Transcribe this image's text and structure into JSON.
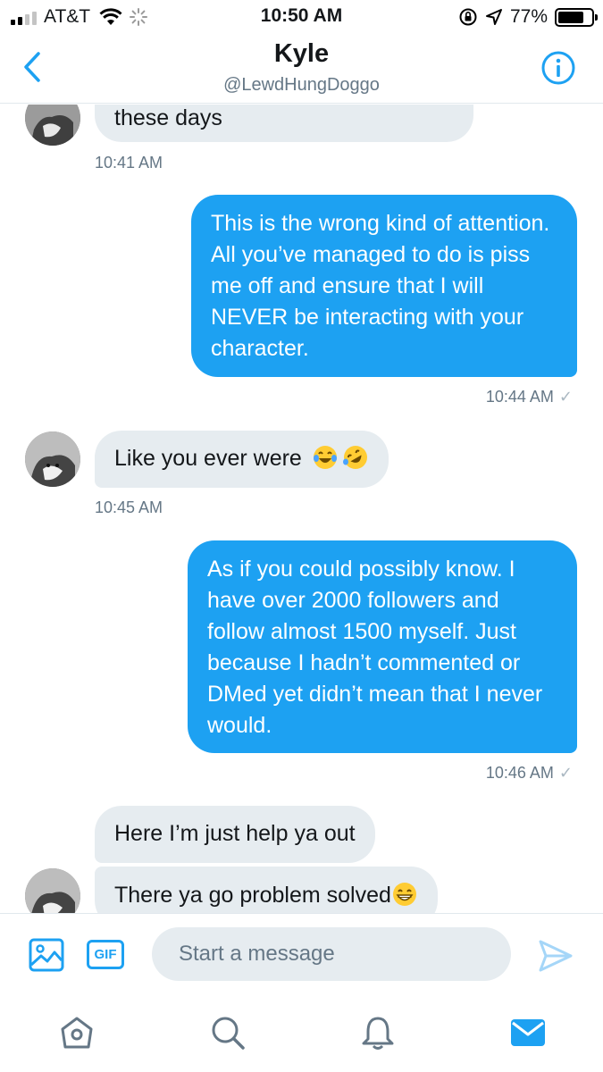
{
  "status_bar": {
    "carrier": "AT&T",
    "time": "10:50 AM",
    "battery": "77%",
    "battery_level": 0.77,
    "signal_bars": 2
  },
  "header": {
    "title": "Kyle",
    "handle": "@LewdHungDoggo",
    "back_icon": "chevron-left-icon",
    "info_icon": "info-icon"
  },
  "messages": [
    {
      "direction": "incoming",
      "text": "these days"
    },
    {
      "direction": "incoming",
      "timestamp": "10:41 AM"
    },
    {
      "direction": "outgoing",
      "text": "This is the wrong kind of attention. All you’ve managed to do is piss me off and ensure that I will NEVER be interacting with your character.",
      "timestamp": "10:44 AM",
      "status": "✓"
    },
    {
      "direction": "incoming",
      "text": "Like you ever were",
      "emojis": [
        "tears-of-joy-emoji",
        "rolling-on-floor-laughing-emoji"
      ],
      "timestamp": "10:45 AM"
    },
    {
      "direction": "outgoing",
      "text": "As if you could possibly know. I have over 2000 followers and follow almost 1500 myself. Just because I hadn’t commented or DMed yet didn’t mean that I never would.",
      "timestamp": "10:46 AM",
      "status": "✓"
    },
    {
      "direction": "incoming",
      "text": "Here I’m just help ya out"
    },
    {
      "direction": "incoming",
      "text": "There ya go problem solved",
      "emojis": [
        "grinning-face-emoji"
      ]
    }
  ],
  "composer": {
    "placeholder": "Start a message",
    "gif_label": "GIF"
  },
  "tab_bar": {
    "items": [
      "home-icon",
      "search-icon",
      "notifications-icon",
      "messages-icon"
    ],
    "active": "messages-icon"
  },
  "colors": {
    "accent": "#1da1f2",
    "incoming_bubble": "#e6ecf0",
    "secondary_text": "#657786"
  }
}
